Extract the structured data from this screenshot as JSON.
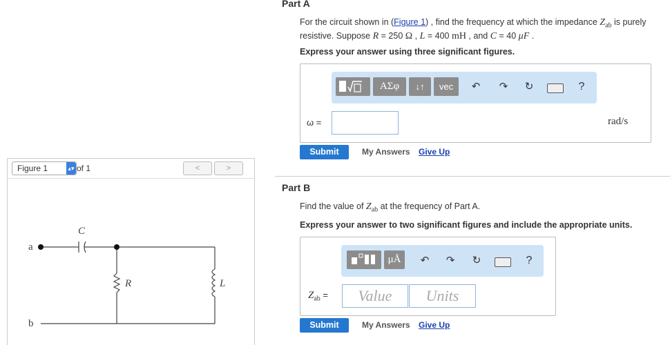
{
  "part_a": {
    "title": "Part A",
    "q_intro": "For the circuit shown in (",
    "figure_link": "Figure 1",
    "q_rest1": ") , find the frequency at which the impedance ",
    "z_symbol": "Z",
    "z_sub": "ab",
    "q_rest2": " is purely",
    "q_line2_a": "resistive. Suppose ",
    "r_sym": "R",
    "r_val": " = 250 ",
    "r_unit": "Ω",
    "sep1": " , ",
    "l_sym": "L",
    "l_val": " = 400 ",
    "l_unit": "mH",
    "sep2": " , and ",
    "c_sym": "C",
    "c_val": " = 40 ",
    "c_unit": "μF",
    "end": " .",
    "instruction": "Express your answer using three significant figures.",
    "toolbar": [
      "ΑΣφ",
      "↓↑",
      "vec"
    ],
    "input_label": "ω =",
    "input_value": "",
    "unit": "rad/s",
    "submit": "Submit",
    "my_answers": "My Answers",
    "give_up": "Give Up"
  },
  "part_b": {
    "title": "Part B",
    "q_a": "Find the value of ",
    "z_symbol": "Z",
    "z_sub": "ab",
    "q_b": " at the frequency of Part A.",
    "instruction": "Express your answer to two significant figures and include the appropriate units.",
    "toolbar": [
      "μÅ"
    ],
    "input_label_sym": "Z",
    "input_label_sub": "ab",
    "input_label_eq": " =",
    "value_placeholder": "Value",
    "units_placeholder": "Units",
    "submit": "Submit",
    "my_answers": "My Answers",
    "give_up": "Give Up"
  },
  "figure": {
    "select_label": "Figure 1",
    "of_label": "of 1",
    "prev": "<",
    "next": ">",
    "labels": {
      "a": "a",
      "b": "b",
      "C": "C",
      "R": "R",
      "L": "L"
    }
  },
  "toolbar_icons": [
    "fraction-root-icon",
    "undo-icon",
    "redo-icon",
    "reset-icon",
    "keyboard-icon",
    "help-icon"
  ],
  "help": "?"
}
